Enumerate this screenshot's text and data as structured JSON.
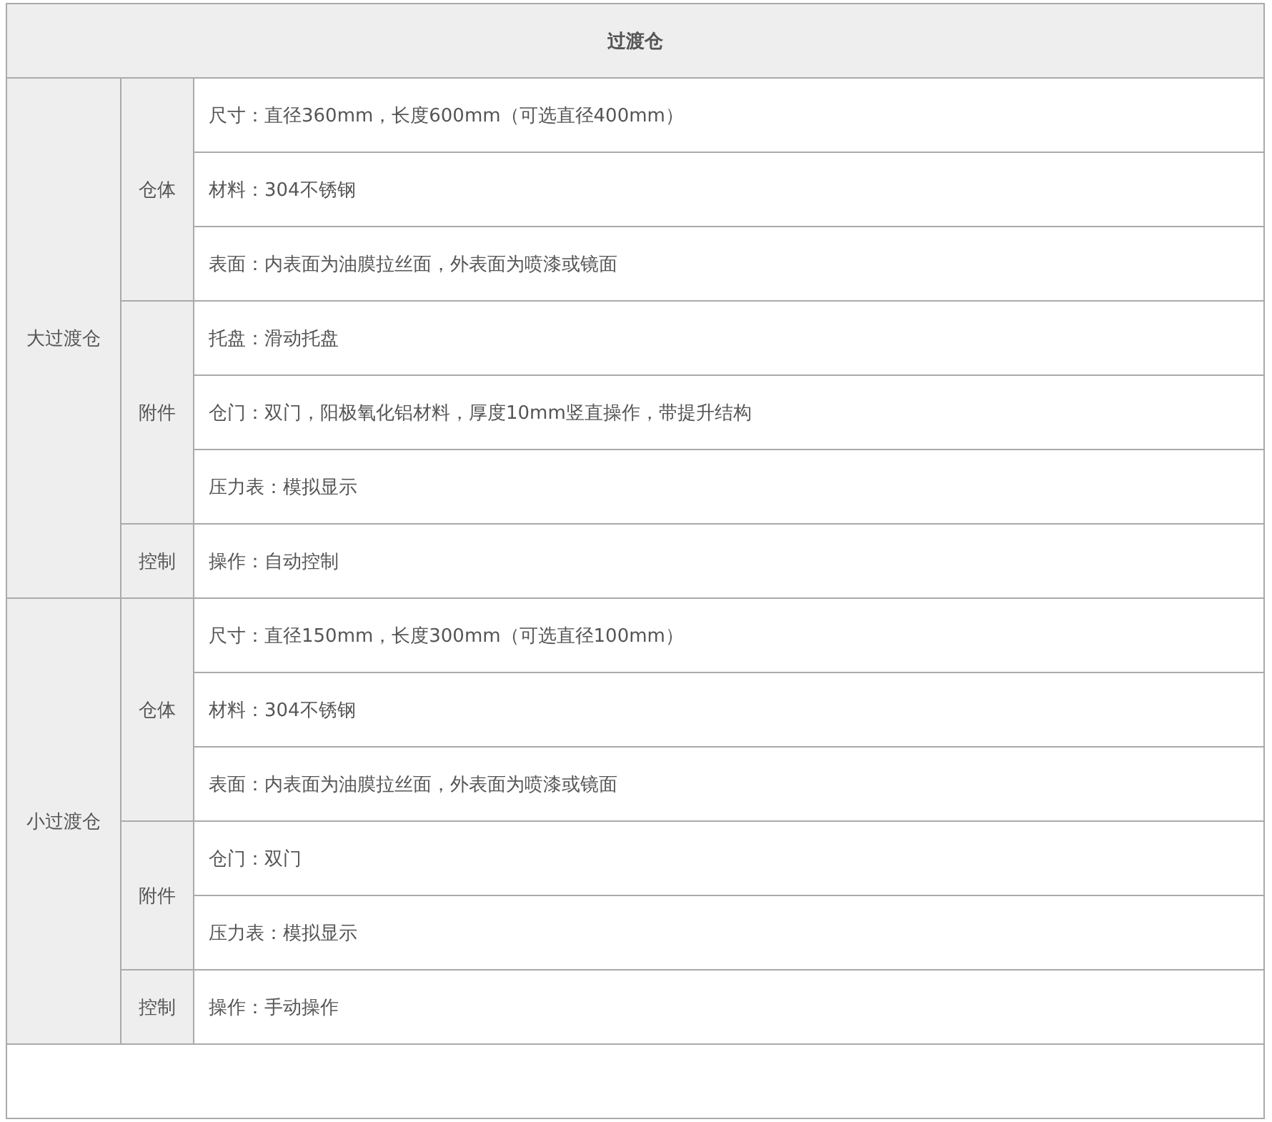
{
  "table": {
    "title": "过渡仓",
    "groups": [
      {
        "name": "大过渡仓",
        "sections": [
          {
            "name": "仓体",
            "items": [
              "尺寸：直径360mm，长度600mm（可选直径400mm）",
              "材料：304不锈钢",
              "表面：内表面为油膜拉丝面，外表面为喷漆或镜面"
            ]
          },
          {
            "name": "附件",
            "items": [
              "托盘：滑动托盘",
              "仓门：双门，阳极氧化铝材料，厚度10mm竖直操作，带提升结构",
              "压力表：模拟显示"
            ]
          },
          {
            "name": "控制",
            "items": [
              "操作：自动控制"
            ]
          }
        ]
      },
      {
        "name": "小过渡仓",
        "sections": [
          {
            "name": "仓体",
            "items": [
              "尺寸：直径150mm，长度300mm（可选直径100mm）",
              "材料：304不锈钢",
              "表面：内表面为油膜拉丝面，外表面为喷漆或镜面"
            ]
          },
          {
            "name": "附件",
            "items": [
              "仓门：双门",
              "压力表：模拟显示"
            ]
          },
          {
            "name": "控制",
            "items": [
              "操作：手动操作"
            ]
          }
        ]
      }
    ]
  }
}
